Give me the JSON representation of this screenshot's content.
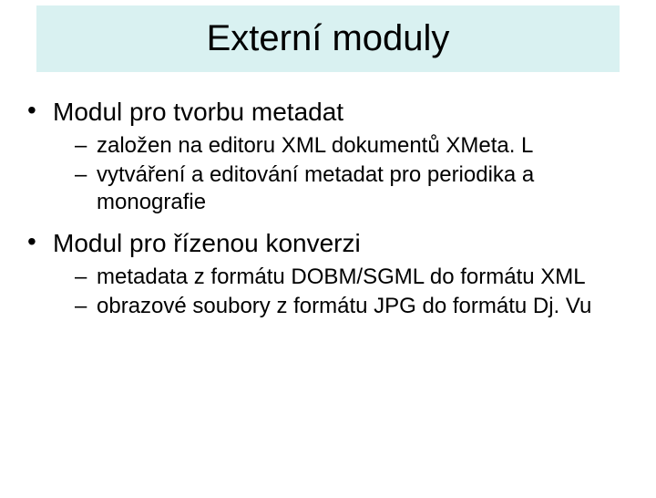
{
  "title": "Externí moduly",
  "bullets": [
    {
      "text": "Modul pro tvorbu metadat",
      "sub": [
        "založen na editoru XML dokumentů XMeta. L",
        "vytváření a editování metadat pro periodika a monografie"
      ]
    },
    {
      "text": "Modul pro řízenou konverzi",
      "sub": [
        "metadata z formátu DOBM/SGML do formátu XML",
        "obrazové soubory z formátu JPG do formátu Dj. Vu"
      ]
    }
  ]
}
